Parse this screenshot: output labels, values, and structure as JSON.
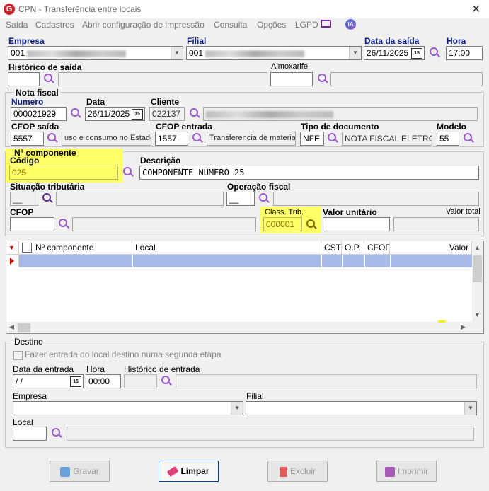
{
  "window": {
    "title": "CPN - Transferência entre locais",
    "close_glyph": "✕",
    "logo_letter": "G"
  },
  "menu": [
    "Saída",
    "Cadastros",
    "Abrir configuração de impressão",
    "Consulta",
    "Opções",
    "LGPD"
  ],
  "menu_ia": "IA",
  "header": {
    "empresa_label": "Empresa",
    "empresa_code": "001",
    "filial_label": "Filial",
    "filial_code": "001",
    "data_saida_label": "Data da saída",
    "data_saida": "26/11/2025",
    "hora_label": "Hora",
    "hora": "17:00",
    "historico_label": "Histórico de saída",
    "almoxarife_label": "Almoxarife"
  },
  "nota": {
    "group_label": "Nota fiscal",
    "numero_label": "Numero",
    "numero": "000021929",
    "data_label": "Data",
    "data": "26/11/2025",
    "cliente_label": "Cliente",
    "cliente": "022137",
    "cfop_saida_label": "CFOP saída",
    "cfop_saida": "5557",
    "cfop_saida_desc": "uso e consumo no Estado",
    "cfop_entrada_label": "CFOP entrada",
    "cfop_entrada": "1557",
    "cfop_entrada_desc": "Transferencia de material",
    "tipo_doc_label": "Tipo de documento",
    "tipo_doc": "NFE",
    "tipo_doc_desc": "NOTA FISCAL ELETRON",
    "modelo_label": "Modelo",
    "modelo": "55"
  },
  "componente": {
    "group_label": "Nº componente",
    "codigo_label": "Código",
    "codigo": "025",
    "descricao_label": "Descrição",
    "descricao": "COMPONENTE NUMERO 25",
    "situacao_label": "Situação tributária",
    "situacao": "__",
    "operacao_label": "Operação fiscal",
    "operacao": "__",
    "cfop_label": "CFOP",
    "class_trib_label": "Class. Trib.",
    "class_trib": "000001",
    "valor_unitario_label": "Valor unitário",
    "valor_total_label": "Valor total"
  },
  "grid": {
    "columns": [
      "Nº componente",
      "Local",
      "CST",
      "O.P.",
      "CFOP",
      "Valor"
    ]
  },
  "destino": {
    "group_label": "Destino",
    "checkbox_label": "Fazer entrada do local destino numa segunda etapa",
    "data_entrada_label": "Data da entrada",
    "data_entrada": " / /",
    "hora_label": "Hora",
    "hora": "00:00",
    "historico_label": "Histórico de entrada",
    "empresa_label": "Empresa",
    "filial_label": "Filial",
    "local_label": "Local"
  },
  "buttons": {
    "gravar": "Gravar",
    "limpar": "Limpar",
    "excluir": "Excluir",
    "imprimir": "Imprimir"
  },
  "colors": {
    "highlight": "#ffff66",
    "label_blue": "#0a1d8f",
    "icon_purple": "#9b59d0",
    "selected_row": "#a9b9e6"
  }
}
